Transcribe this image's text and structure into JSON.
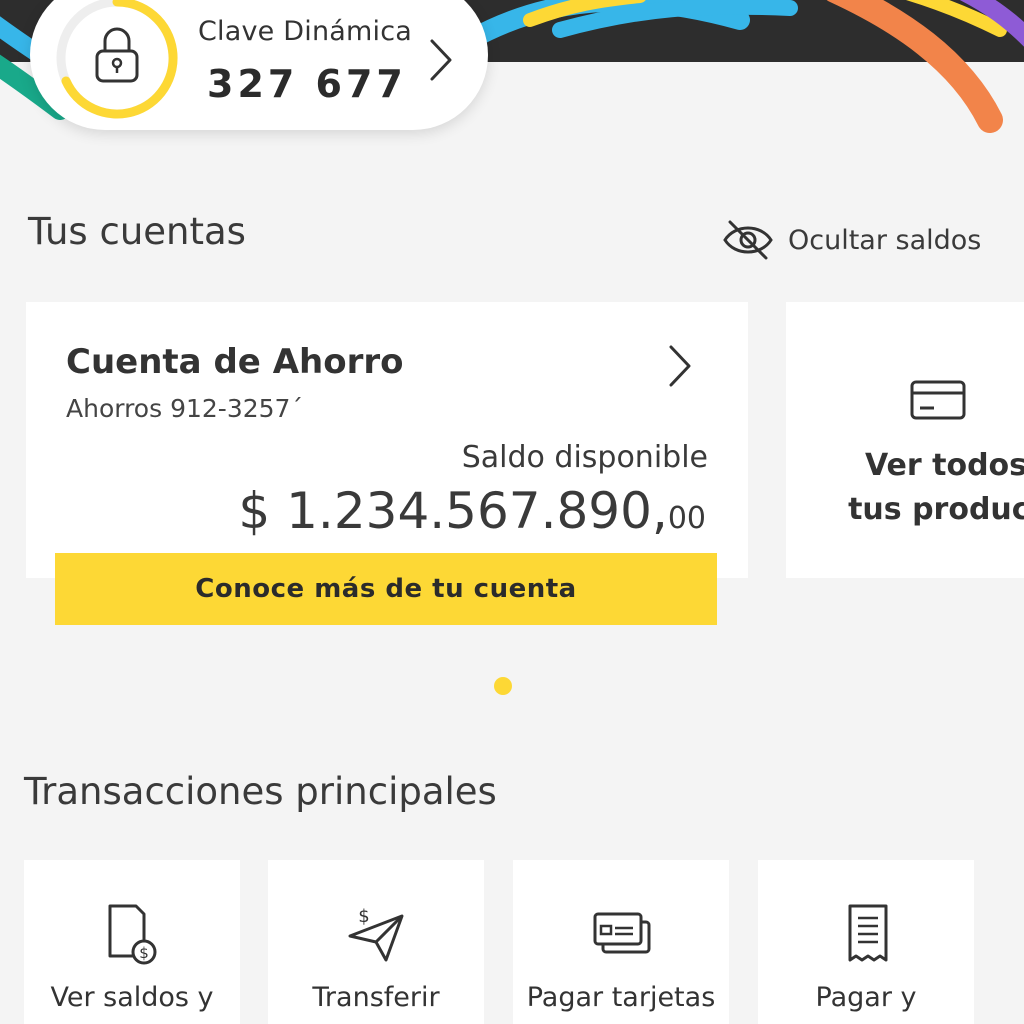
{
  "clave": {
    "label": "Clave Dinámica",
    "code": "327 677"
  },
  "accounts": {
    "title": "Tus cuentas",
    "hide_balances_label": "Ocultar saldos",
    "card": {
      "name": "Cuenta de Ahorro",
      "number": "Ahorros 912-3257´",
      "balance_label": "Saldo disponible",
      "balance_main": "$ 1.234.567.890,",
      "balance_cents": "00",
      "cta_label": "Conoce más de tu cuenta"
    },
    "products_card": {
      "line1": "Ver todos",
      "line2": "tus product"
    }
  },
  "transactions": {
    "title": "Transacciones principales",
    "tiles": [
      {
        "label": "Ver saldos y",
        "icon": "document-balance-icon"
      },
      {
        "label": "Transferir",
        "icon": "transfer-plane-icon"
      },
      {
        "label": "Pagar tarjetas",
        "icon": "credit-cards-icon"
      },
      {
        "label": "Pagar y",
        "icon": "receipt-icon"
      }
    ]
  },
  "colors": {
    "accent_yellow": "#fdd835",
    "background": "#f4f4f4",
    "header_dark": "#2d2d2d",
    "ribbon_blue": "#37b6e9",
    "ribbon_orange": "#f2844a",
    "ribbon_purple": "#8e5bd6",
    "ribbon_green": "#19a98a"
  }
}
